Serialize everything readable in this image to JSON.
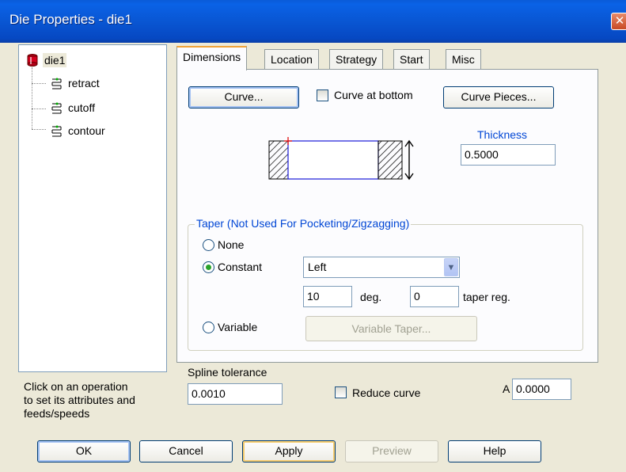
{
  "window": {
    "title": "Die Properties - die1",
    "close_label": "✕"
  },
  "tree": {
    "root": "die1",
    "children": [
      "retract",
      "cutoff",
      "contour"
    ]
  },
  "hint": "Click on an operation\nto set its attributes and\nfeeds/speeds",
  "tabs": [
    "Dimensions",
    "Location",
    "Strategy",
    "Start",
    "Misc"
  ],
  "active_tab": "Dimensions",
  "dimensions": {
    "curve_button": "Curve...",
    "curve_at_bottom": {
      "label": "Curve at bottom",
      "checked": false
    },
    "curve_pieces_button": "Curve Pieces...",
    "thickness_label": "Thickness",
    "thickness_value": "0.5000",
    "taper": {
      "title": "Taper (Not Used For Pocketing/Zigzagging)",
      "options": [
        "None",
        "Constant",
        "Variable"
      ],
      "selected": "Constant",
      "side_select": "Left",
      "angle_value": "10",
      "angle_unit": "deg.",
      "taper_reg_value": "0",
      "taper_reg_label": "taper reg.",
      "variable_taper_button": "Variable Taper..."
    },
    "spline_tolerance_label": "Spline tolerance",
    "spline_tolerance_value": "0.0010",
    "reduce_curve": {
      "label": "Reduce curve",
      "checked": false
    },
    "a_label": "A",
    "a_value": "0.0000"
  },
  "buttons": {
    "ok": "OK",
    "cancel": "Cancel",
    "apply": "Apply",
    "preview": "Preview",
    "help": "Help"
  },
  "colors": {
    "titlebar": "#0a5bd8",
    "group_title": "#0046d5",
    "diagram_outline": "#1a1ad8",
    "marker": "#e00000"
  },
  "icons": {
    "die": "die-icon",
    "operation": "operation-icon"
  }
}
